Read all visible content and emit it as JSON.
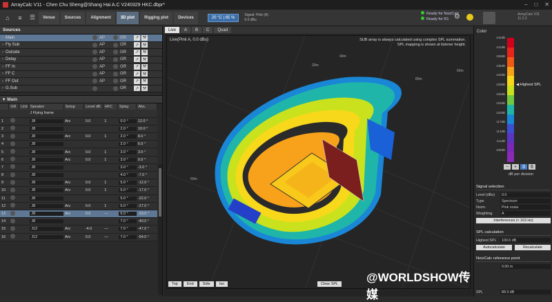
{
  "window": {
    "title": "ArrayCalc V11 - Chen Chu Sheng@Shang Hai A.C V240329 HKC.dbpr*",
    "controls": [
      "–",
      "□",
      "✕"
    ]
  },
  "toolbar": {
    "tabs": [
      "Venue",
      "Sources",
      "Alignment",
      "3D plot",
      "Rigging plot",
      "Devices"
    ],
    "active_tab": "3D plot",
    "temperature": "20 °C | 65 %",
    "signal_label": "Signal: Pink (A)",
    "signal_value": "0.0 dBu",
    "ready_1": "Ready for NoizCalc",
    "ready_2": "Ready for R1",
    "brand_line1": "ArrayCalc V11",
    "brand_line2": "11.2.2"
  },
  "sources": {
    "header": "Sources",
    "rows": [
      {
        "name": "Main",
        "ap": "AP",
        "gr": "GR"
      },
      {
        "name": "Fly Sub",
        "ap": "AP",
        "gr": "GR"
      },
      {
        "name": "Outside",
        "ap": "AP",
        "gr": "GR"
      },
      {
        "name": "Delay",
        "ap": "AP",
        "gr": "GR"
      },
      {
        "name": "FF In",
        "ap": "AP",
        "gr": "GR"
      },
      {
        "name": "FF C",
        "ap": "AP",
        "gr": "GR"
      },
      {
        "name": "FF Out",
        "ap": "AP",
        "gr": "GR"
      },
      {
        "name": "G.Sub",
        "ap": "",
        "gr": "GR"
      }
    ]
  },
  "main": {
    "header": "Main",
    "columns": [
      "GR",
      "Link",
      "Speaker",
      "Setup",
      "Level dB",
      "HFC",
      "Splay",
      "Abs."
    ],
    "frame": "J Flying frame",
    "rows": [
      {
        "n": "1",
        "spk": "J8",
        "setup": "Arc",
        "lvl": "0.0",
        "hfc": "1",
        "splay": "0.0 °",
        "abs": "12.0 °"
      },
      {
        "n": "2",
        "spk": "J8",
        "setup": "",
        "lvl": "",
        "hfc": "",
        "splay": "2.0 °",
        "abs": "10.0 °"
      },
      {
        "n": "3",
        "spk": "J8",
        "setup": "Arc",
        "lvl": "0.0",
        "hfc": "1",
        "splay": "2.0 °",
        "abs": "8.0 °"
      },
      {
        "n": "4",
        "spk": "J8",
        "setup": "",
        "lvl": "",
        "hfc": "",
        "splay": "2.0 °",
        "abs": "6.0 °"
      },
      {
        "n": "5",
        "spk": "J8",
        "setup": "Arc",
        "lvl": "0.0",
        "hfc": "1",
        "splay": "3.0 °",
        "abs": "3.0 °"
      },
      {
        "n": "6",
        "spk": "J8",
        "setup": "Arc",
        "lvl": "0.0",
        "hfc": "1",
        "splay": "3.0 °",
        "abs": "0.0 °"
      },
      {
        "n": "7",
        "spk": "J8",
        "setup": "",
        "lvl": "",
        "hfc": "",
        "splay": "3.0 °",
        "abs": "-3.0 °"
      },
      {
        "n": "8",
        "spk": "J8",
        "setup": "",
        "lvl": "",
        "hfc": "",
        "splay": "4.0 °",
        "abs": "-7.0 °"
      },
      {
        "n": "9",
        "spk": "J8",
        "setup": "Arc",
        "lvl": "0.0",
        "hfc": "1",
        "splay": "5.0 °",
        "abs": "-12.0 °"
      },
      {
        "n": "10",
        "spk": "J8",
        "setup": "Arc",
        "lvl": "0.0",
        "hfc": "1",
        "splay": "5.0 °",
        "abs": "-17.0 °"
      },
      {
        "n": "11",
        "spk": "J8",
        "setup": "",
        "lvl": "",
        "hfc": "",
        "splay": "5.0 °",
        "abs": "-22.0 °"
      },
      {
        "n": "12",
        "spk": "J8",
        "setup": "Arc",
        "lvl": "0.0",
        "hfc": "1",
        "splay": "5.0 °",
        "abs": "-27.0 °"
      },
      {
        "n": "13",
        "spk": "J8",
        "setup": "Arc",
        "lvl": "0.0",
        "hfc": "—",
        "splay": "6.0 °",
        "abs": "-33.0 °"
      },
      {
        "n": "14",
        "spk": "J8",
        "setup": "",
        "lvl": "",
        "hfc": "",
        "splay": "7.0 °",
        "abs": "-40.0 °"
      },
      {
        "n": "15",
        "spk": "J12",
        "setup": "Arc",
        "lvl": "-4.0",
        "hfc": "—",
        "splay": "7.0 °",
        "abs": "-47.0 °"
      },
      {
        "n": "16",
        "spk": "J12",
        "setup": "Arc",
        "lvl": "0.0",
        "hfc": "—",
        "splay": "7.0 °",
        "abs": "-54.0 °"
      }
    ]
  },
  "view": {
    "tabs": [
      "Live",
      "A",
      "B",
      "C",
      "Quad"
    ],
    "live_label": "Live(Pink A, 0.0 dBu)",
    "note_line1": "SUB array is always calculated using complex SPL summation.",
    "note_line2": "SPL mapping is shown at listener height.",
    "dist_labels": [
      "20m",
      "40m",
      "60m",
      "80m",
      "60m"
    ],
    "bottom_buttons": [
      "Top",
      "End",
      "Side",
      "Iso"
    ],
    "clear_button": "Clear SPL",
    "watermark": "@WORLDSHOW传媒"
  },
  "color_panel": {
    "title": "Color",
    "ticks": [
      "144dB",
      "141dB",
      "138dB",
      "135dB",
      "132dB",
      "129dB",
      "126dB",
      "123dB",
      "120dB",
      "117dB",
      "114dB",
      "111dB",
      "108dB"
    ],
    "highest_label": "Highest SPL",
    "db_per_div_value": "3",
    "db_per_div_alt": "6",
    "db_per_div_label": "dB per division",
    "colors": [
      "#d0021b",
      "#e8251a",
      "#f05a14",
      "#f7a21a",
      "#f8d81a",
      "#c9e21d",
      "#6fc840",
      "#1fb6a9",
      "#1a86d6",
      "#3b4fd0",
      "#5a35c1",
      "#7b27b8",
      "#8a2ab5"
    ]
  },
  "signal_selection": {
    "title": "Signal selection",
    "level_label": "Level (dBu)",
    "level_value": "0.0",
    "type_label": "Type",
    "type_value": "Spectrum",
    "norm_label": "Norm.",
    "norm_value": "Pink noise",
    "weight_label": "Weighting",
    "weight_value": "A",
    "interference": "Interferences (< 163 Hz)"
  },
  "spl_calc": {
    "title": "SPL calculation",
    "highest_label": "Highest SPL",
    "highest_value": "100.6 dB",
    "autocalc": "Autocalculate",
    "recalc": "Recalculate"
  },
  "noizcalc": {
    "title": "NoizCalc reference point",
    "x_value": "0.00 m",
    "spl_label": "SPL",
    "spl_value": "88.3 dB"
  }
}
